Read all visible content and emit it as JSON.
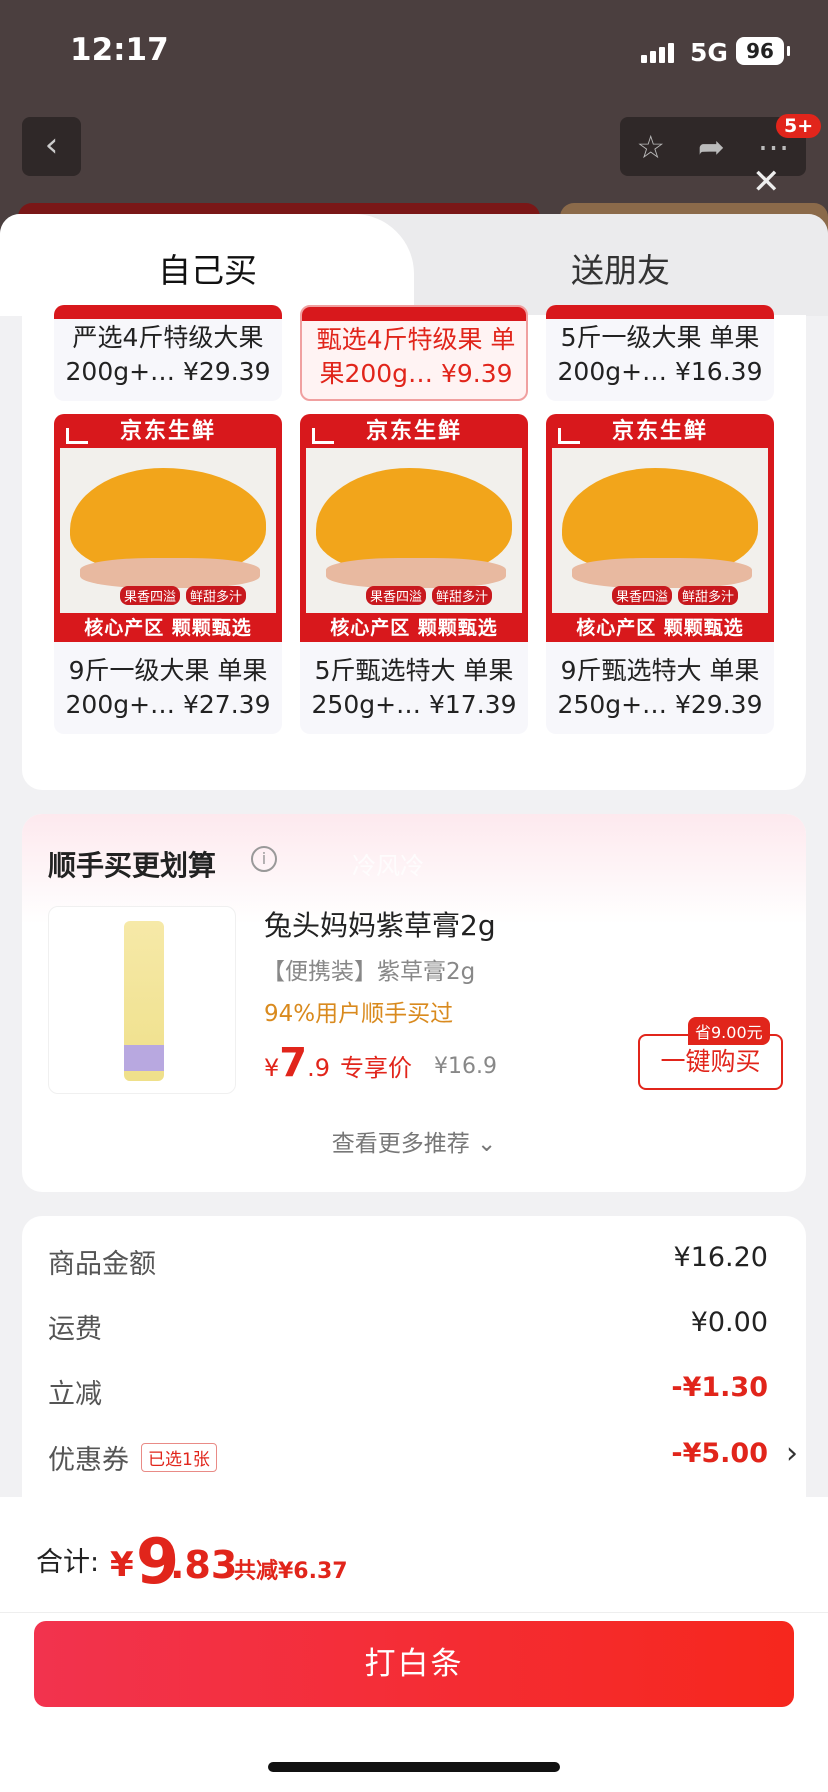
{
  "status_bar": {
    "time": "12:17",
    "network": "5G",
    "battery": "96"
  },
  "nav": {
    "back_icon": "‹",
    "badge": "5+",
    "close_icon": "✕"
  },
  "tabs": [
    {
      "label": "自己买"
    },
    {
      "label": "送朋友"
    }
  ],
  "products_top": [
    {
      "title_l1": "严选4斤特级大果",
      "title_l2": "200g+… ¥29.39"
    },
    {
      "title_l1": "甄选4斤特级果 单",
      "title_l2": "果200g… ¥9.39"
    },
    {
      "title_l1": "5斤一级大果 单果",
      "title_l2": "200g+… ¥16.39"
    }
  ],
  "products": [
    {
      "brand": "京东生鲜",
      "tag1": "果香四溢",
      "tag2": "鲜甜多汁",
      "band": "核心产区 颗颗甄选",
      "title_l1": "9斤一级大果 单果",
      "title_l2": "200g+… ¥27.39"
    },
    {
      "brand": "京东生鲜",
      "tag1": "果香四溢",
      "tag2": "鲜甜多汁",
      "band": "核心产区 颗颗甄选",
      "title_l1": "5斤甄选特大 单果",
      "title_l2": "250g+… ¥17.39"
    },
    {
      "brand": "京东生鲜",
      "tag1": "果香四溢",
      "tag2": "鲜甜多汁",
      "band": "核心产区 颗颗甄选",
      "title_l1": "9斤甄选特大 单果",
      "title_l2": "250g+… ¥29.39"
    }
  ],
  "bundle": {
    "title": "顺手买更划算",
    "info_icon": "i",
    "watermark": "冷风冷",
    "name": "兔头妈妈紫草膏2g",
    "sub": "【便携装】紫草膏2g",
    "pct": "94%用户顺手买过",
    "price_sym": "¥",
    "price_int": "7",
    "price_dec": ".9",
    "price_label": "专享价",
    "old_price": "¥16.9",
    "save_tag": "省9.00元",
    "buy_label": "一键购买",
    "more": "查看更多推荐 ⌄"
  },
  "summary": {
    "rows": [
      {
        "label": "商品金额",
        "value": "¥16.20"
      },
      {
        "label": "运费",
        "value": "¥0.00"
      },
      {
        "label": "立减",
        "value": "-¥1.30"
      },
      {
        "label": "优惠券",
        "value": "-¥5.00",
        "badge": "已选1张"
      }
    ]
  },
  "footer": {
    "total_label": "合计:",
    "sym": "¥",
    "int": "9",
    "dec": ".83",
    "saved": "共减¥6.37",
    "pay_label": "打白条"
  },
  "colors": {
    "accent": "#e1251b",
    "pay_start": "#f2334e",
    "pay_end": "#f6271d"
  }
}
